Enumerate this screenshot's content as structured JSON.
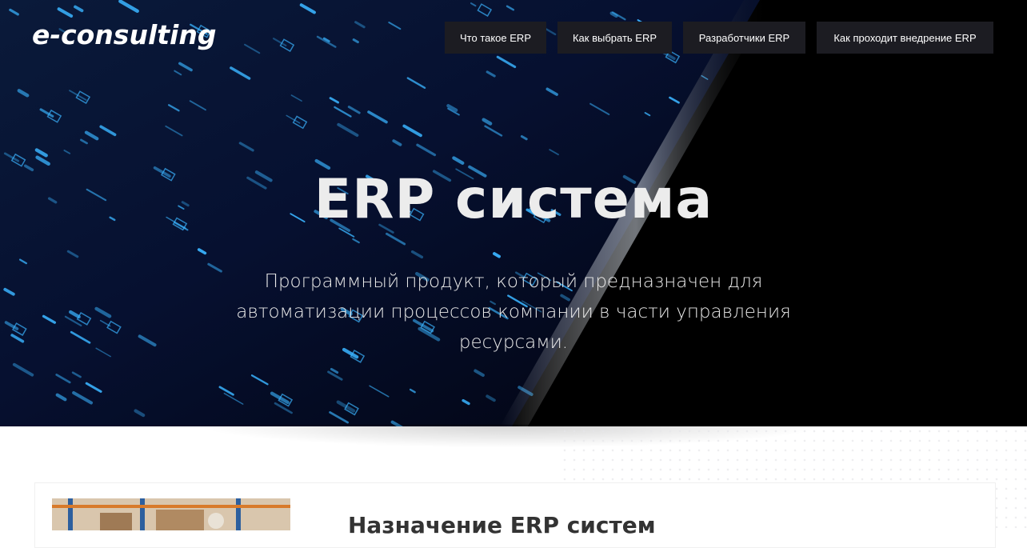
{
  "header": {
    "logo": "e-consulting",
    "nav": [
      {
        "label": "Что такое ERP"
      },
      {
        "label": "Как выбрать ERP"
      },
      {
        "label": "Разработчики ERP"
      },
      {
        "label": "Как проходит внедрение ERP"
      }
    ]
  },
  "hero": {
    "title": "ERP система",
    "subtitle_line1": "Программный продукт, который предназначен для",
    "subtitle_line2": "автоматизации процессов компании в части управления",
    "subtitle_line3": "ресурсами."
  },
  "section": {
    "title": "Назначение ERP систем"
  },
  "colors": {
    "hero_bg": "#000000",
    "nav_button_bg": "#1c1c22",
    "accent_blue": "#2aa8ff"
  }
}
